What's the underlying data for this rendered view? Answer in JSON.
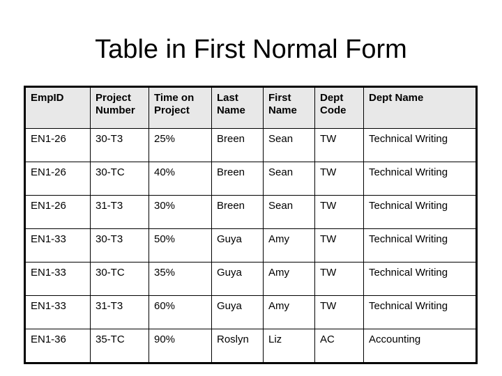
{
  "slide": {
    "title": "Table in First Normal Form",
    "background_color": "#ffffff",
    "text_color": "#000000"
  },
  "table": {
    "header_background": "#e8e8e8",
    "border_color": "#000000",
    "columns": [
      {
        "key": "emp_id",
        "label": "EmpID"
      },
      {
        "key": "project_number",
        "label": "Project Number"
      },
      {
        "key": "time_on_project",
        "label": "Time on Project"
      },
      {
        "key": "last_name",
        "label": "Last Name"
      },
      {
        "key": "first_name",
        "label": "First Name"
      },
      {
        "key": "dept_code",
        "label": "Dept Code"
      },
      {
        "key": "dept_name",
        "label": "Dept Name"
      }
    ],
    "rows": [
      {
        "emp_id": "EN1-26",
        "project_number": "30-T3",
        "time_on_project": "25%",
        "last_name": "Breen",
        "first_name": "Sean",
        "dept_code": "TW",
        "dept_name": "Technical Writing"
      },
      {
        "emp_id": "EN1-26",
        "project_number": "30-TC",
        "time_on_project": "40%",
        "last_name": "Breen",
        "first_name": "Sean",
        "dept_code": "TW",
        "dept_name": "Technical Writing"
      },
      {
        "emp_id": "EN1-26",
        "project_number": "31-T3",
        "time_on_project": "30%",
        "last_name": "Breen",
        "first_name": "Sean",
        "dept_code": "TW",
        "dept_name": "Technical Writing"
      },
      {
        "emp_id": "EN1-33",
        "project_number": "30-T3",
        "time_on_project": "50%",
        "last_name": "Guya",
        "first_name": "Amy",
        "dept_code": "TW",
        "dept_name": "Technical Writing"
      },
      {
        "emp_id": "EN1-33",
        "project_number": "30-TC",
        "time_on_project": "35%",
        "last_name": "Guya",
        "first_name": "Amy",
        "dept_code": "TW",
        "dept_name": "Technical Writing"
      },
      {
        "emp_id": "EN1-33",
        "project_number": "31-T3",
        "time_on_project": "60%",
        "last_name": "Guya",
        "first_name": "Amy",
        "dept_code": "TW",
        "dept_name": "Technical Writing"
      },
      {
        "emp_id": "EN1-36",
        "project_number": "35-TC",
        "time_on_project": "90%",
        "last_name": "Roslyn",
        "first_name": "Liz",
        "dept_code": "AC",
        "dept_name": "Accounting"
      }
    ]
  }
}
